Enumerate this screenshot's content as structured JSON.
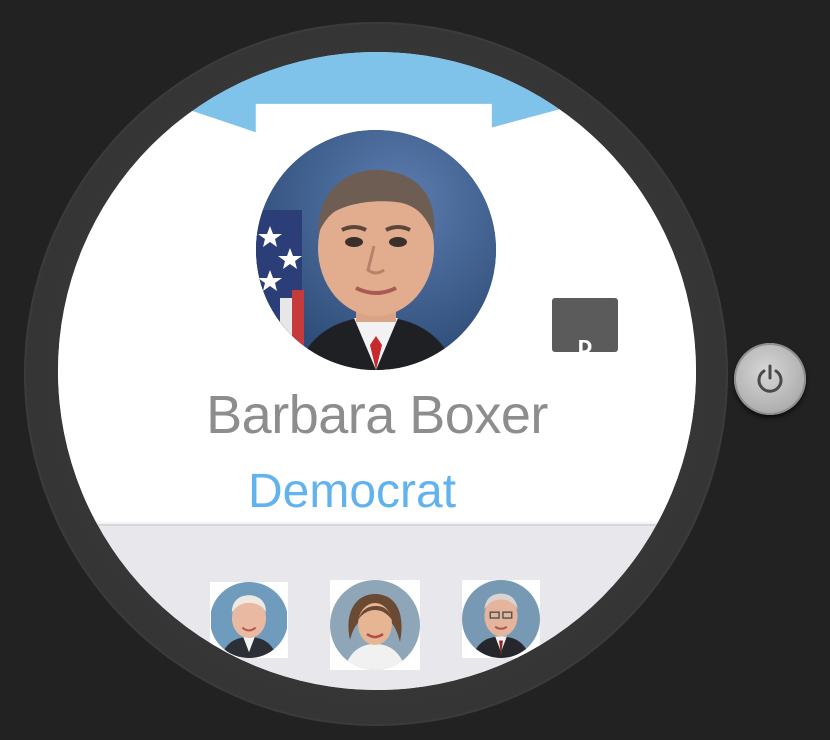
{
  "profile": {
    "name": "Barbara Boxer",
    "party": "Democrat",
    "party_badge": "D"
  },
  "colors": {
    "accent_blue": "#7fc2ea",
    "party_text": "#62b2ee",
    "name_text": "#8d8d8d",
    "badge_bg": "#5b5b5b"
  },
  "icons": {
    "power": "power-icon"
  },
  "carousel": {
    "items": [
      {
        "kind": "senator-photo"
      },
      {
        "kind": "senator-photo"
      },
      {
        "kind": "senator-photo"
      }
    ]
  }
}
